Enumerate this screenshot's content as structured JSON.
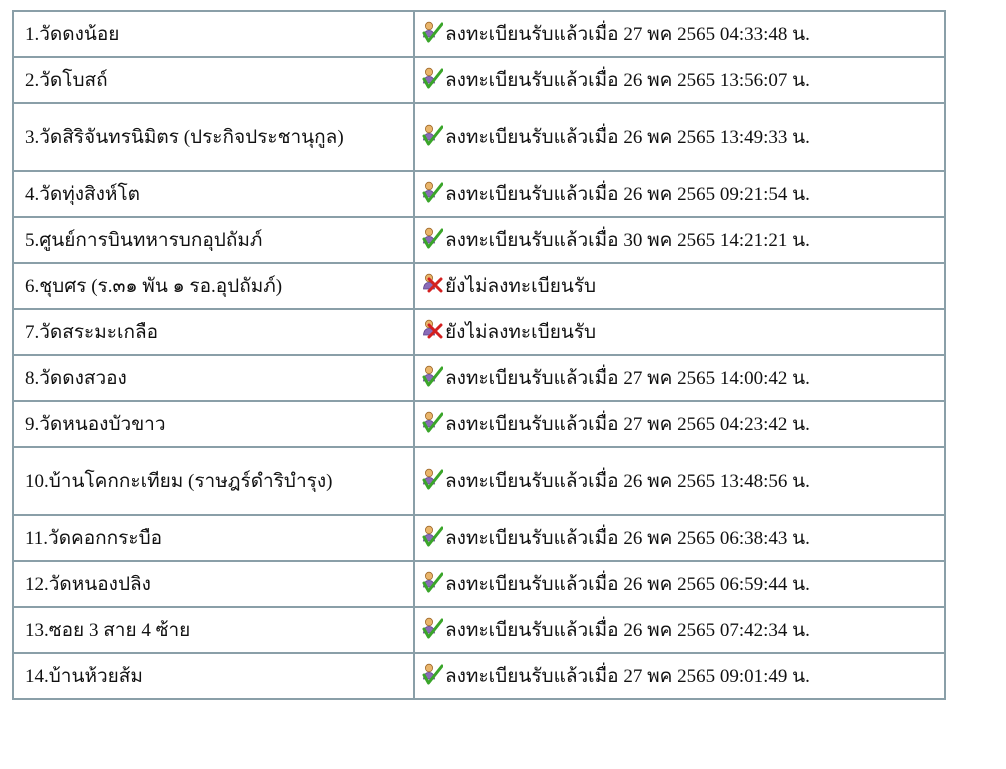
{
  "rows": [
    {
      "name": "1.วัดดงน้อย",
      "registered": true,
      "status": "ลงทะเบียนรับแล้วเมื่อ 27 พค 2565 04:33:48 น."
    },
    {
      "name": "2.วัดโบสถ์",
      "registered": true,
      "status": "ลงทะเบียนรับแล้วเมื่อ 26 พค 2565 13:56:07 น."
    },
    {
      "name": "3.วัดสิริจันทรนิมิตร (ประกิจประชานุกูล)",
      "registered": true,
      "status": "ลงทะเบียนรับแล้วเมื่อ 26 พค 2565 13:49:33 น."
    },
    {
      "name": "4.วัดทุ่งสิงห์โต",
      "registered": true,
      "status": "ลงทะเบียนรับแล้วเมื่อ 26 พค 2565 09:21:54 น."
    },
    {
      "name": "5.ศูนย์การบินทหารบกอุปถัมภ์",
      "registered": true,
      "status": "ลงทะเบียนรับแล้วเมื่อ 30 พค 2565 14:21:21 น."
    },
    {
      "name": "6.ชุบศร (ร.๓๑ พัน ๑ รอ.อุปถัมภ์)",
      "registered": false,
      "status": "ยังไม่ลงทะเบียนรับ"
    },
    {
      "name": "7.วัดสระมะเกลือ",
      "registered": false,
      "status": "ยังไม่ลงทะเบียนรับ"
    },
    {
      "name": "8.วัดดงสวอง",
      "registered": true,
      "status": "ลงทะเบียนรับแล้วเมื่อ 27 พค 2565 14:00:42 น."
    },
    {
      "name": "9.วัดหนองบัวขาว",
      "registered": true,
      "status": "ลงทะเบียนรับแล้วเมื่อ 27 พค 2565 04:23:42 น."
    },
    {
      "name": "10.บ้านโคกกะเทียม (ราษฎร์ดำริบำรุง)",
      "registered": true,
      "status": "ลงทะเบียนรับแล้วเมื่อ 26 พค 2565 13:48:56 น."
    },
    {
      "name": "11.วัดคอกกระบือ",
      "registered": true,
      "status": "ลงทะเบียนรับแล้วเมื่อ 26 พค 2565 06:38:43 น."
    },
    {
      "name": "12.วัดหนองปลิง",
      "registered": true,
      "status": "ลงทะเบียนรับแล้วเมื่อ 26 พค 2565 06:59:44 น."
    },
    {
      "name": "13.ซอย 3 สาย 4 ซ้าย",
      "registered": true,
      "status": "ลงทะเบียนรับแล้วเมื่อ 26 พค 2565 07:42:34 น."
    },
    {
      "name": "14.บ้านห้วยส้ม",
      "registered": true,
      "status": "ลงทะเบียนรับแล้วเมื่อ 27 พค 2565 09:01:49 น."
    }
  ],
  "icons": {
    "registered": "user-check-icon",
    "not_registered": "user-cross-icon"
  },
  "colors": {
    "border": "#8a9fa8",
    "check": "#3aa52a",
    "cross": "#d42020"
  }
}
